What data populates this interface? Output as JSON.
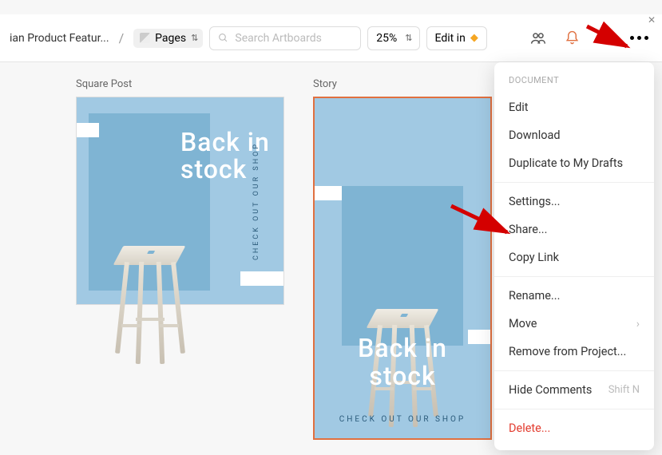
{
  "breadcrumb": {
    "project": "ian Product Featur..."
  },
  "pages": {
    "label": "Pages"
  },
  "search": {
    "placeholder": "Search Artboards"
  },
  "zoom": {
    "value": "25%"
  },
  "editin": {
    "label": "Edit in"
  },
  "artboards": {
    "square": {
      "label": "Square Post",
      "headline1": "Back in",
      "headline2": "stock",
      "tag": "CHECK OUT OUR SHOP"
    },
    "story": {
      "label": "Story",
      "headline1": "Back in",
      "headline2": "stock",
      "tag": "CHECK OUT OUR SHOP"
    }
  },
  "menu": {
    "header": "DOCUMENT",
    "edit": "Edit",
    "download": "Download",
    "duplicate": "Duplicate to My Drafts",
    "settings": "Settings...",
    "share": "Share...",
    "copylink": "Copy Link",
    "rename": "Rename...",
    "move": "Move",
    "remove": "Remove from Project...",
    "hidecomments": "Hide Comments",
    "hidecomments_shortcut": "Shift N",
    "delete": "Delete..."
  }
}
